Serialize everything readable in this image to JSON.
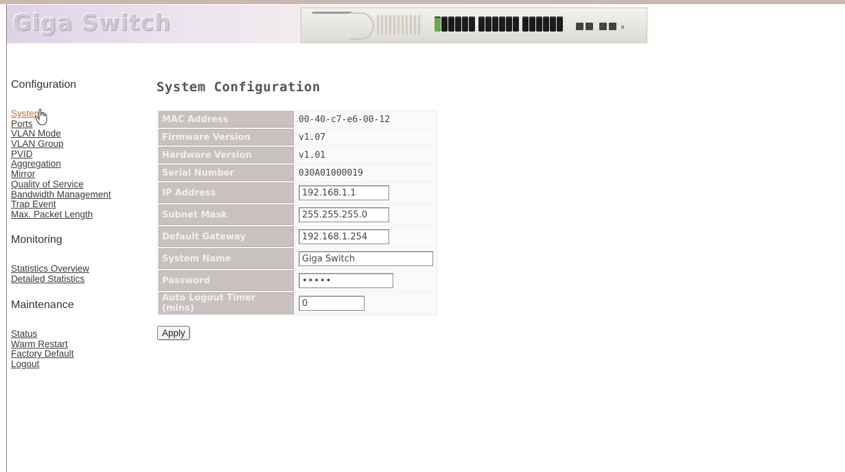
{
  "header": {
    "brand": "Giga Switch"
  },
  "sidebar": {
    "configuration": {
      "title": "Configuration",
      "items": [
        {
          "label": "System",
          "active": true
        },
        {
          "label": "Ports"
        },
        {
          "label": "VLAN Mode"
        },
        {
          "label": "VLAN Group"
        },
        {
          "label": "PVID"
        },
        {
          "label": "Aggregation"
        },
        {
          "label": "Mirror"
        },
        {
          "label": "Quality of Service"
        },
        {
          "label": "Bandwidth Management"
        },
        {
          "label": "Trap Event"
        },
        {
          "label": "Max. Packet Length"
        }
      ]
    },
    "monitoring": {
      "title": "Monitoring",
      "items": [
        {
          "label": "Statistics Overview"
        },
        {
          "label": "Detailed Statistics"
        }
      ]
    },
    "maintenance": {
      "title": "Maintenance",
      "items": [
        {
          "label": "Status"
        },
        {
          "label": "Warm Restart"
        },
        {
          "label": "Factory Default"
        },
        {
          "label": "Logout"
        }
      ]
    }
  },
  "main": {
    "title": "System Configuration",
    "rows": [
      {
        "label": "MAC Address",
        "value": "00-40-c7-e6-00-12"
      },
      {
        "label": "Firmware Version",
        "value": "v1.07"
      },
      {
        "label": "Hardware Version",
        "value": "v1.01"
      },
      {
        "label": "Serial Number",
        "value": "030A01000019"
      }
    ],
    "fields": {
      "ip_address": {
        "label": "IP Address",
        "value": "192.168.1.1"
      },
      "subnet_mask": {
        "label": "Subnet Mask",
        "value": "255.255.255.0"
      },
      "default_gateway": {
        "label": "Default Gateway",
        "value": "192.168.1.254"
      },
      "system_name": {
        "label": "System Name",
        "value": "Giga Switch"
      },
      "password": {
        "label": "Password",
        "value": "•••••"
      },
      "auto_logout": {
        "label": "Auto Logout Timer (mins)",
        "value": "0"
      }
    },
    "apply_label": "Apply"
  }
}
